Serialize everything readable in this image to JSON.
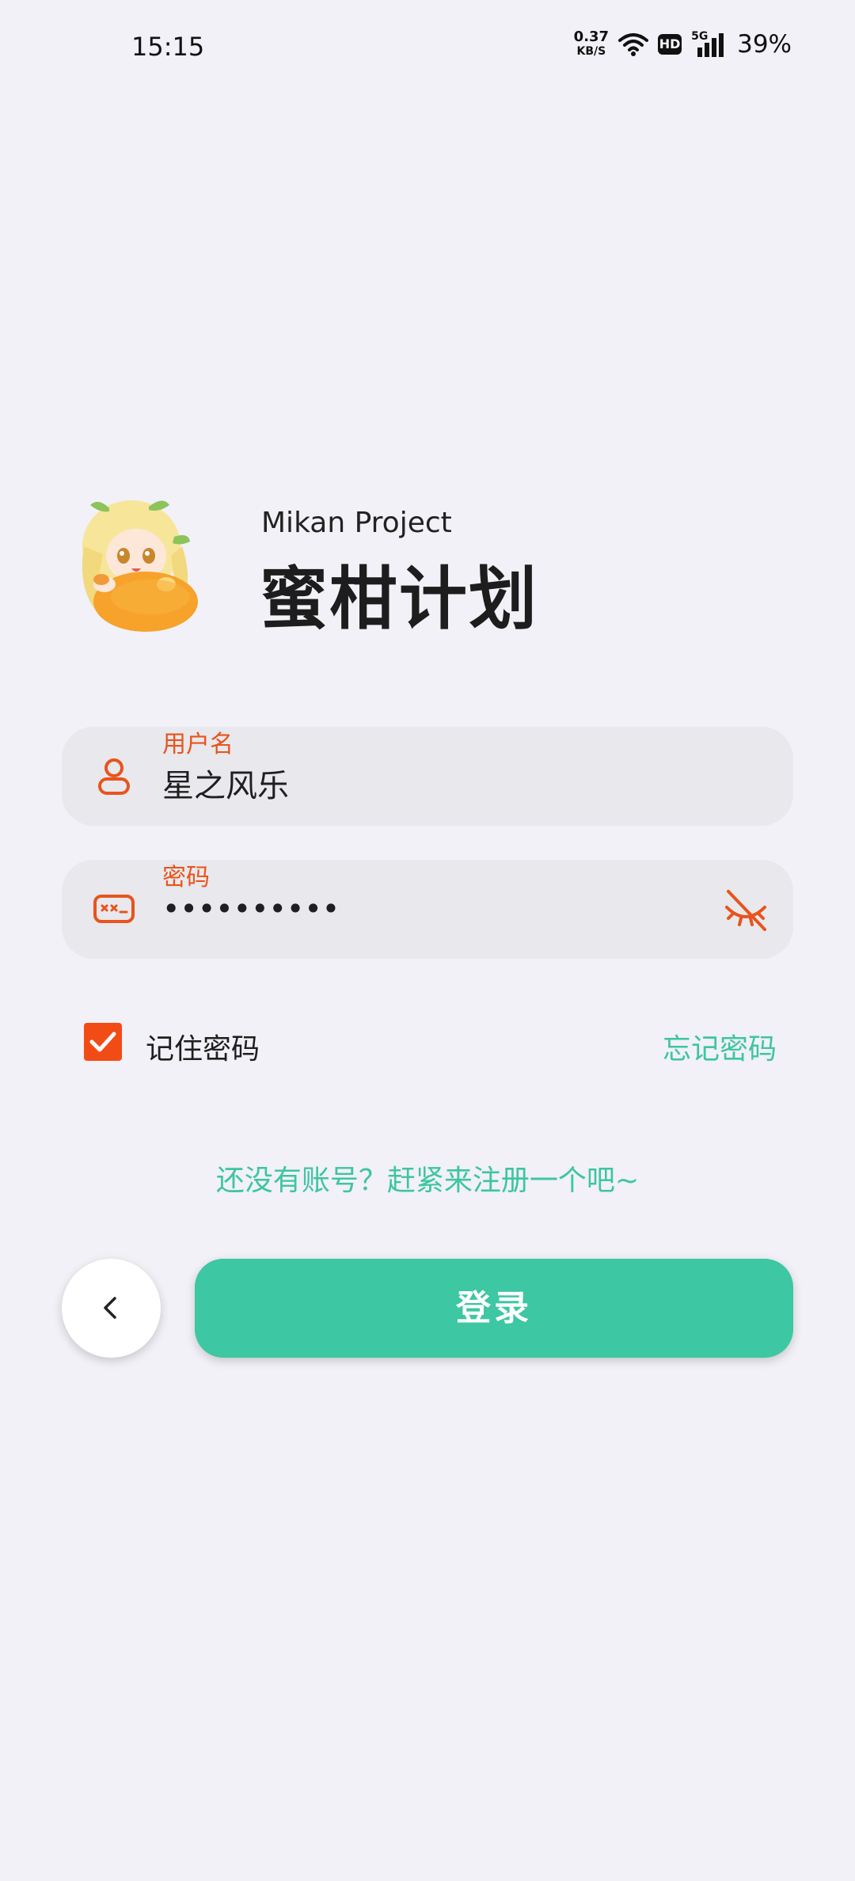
{
  "status_bar": {
    "time": "15:15",
    "net_speed_value": "0.37",
    "net_speed_unit": "KB/S",
    "hd_label": "HD",
    "network_type": "5G",
    "battery": "39%",
    "icons": [
      "wifi-icon",
      "hd-icon",
      "signal-5g-icon"
    ]
  },
  "brand": {
    "subtitle": "Mikan Project",
    "title": "蜜柑计划",
    "logo": "mascot-logo"
  },
  "form": {
    "username": {
      "label": "用户名",
      "value": "星之风乐",
      "icon": "user-icon"
    },
    "password": {
      "label": "密码",
      "value": "••••••••••",
      "icon": "password-icon",
      "toggle_icon": "eye-off-icon"
    },
    "remember": {
      "label": "记住密码",
      "checked": true
    },
    "forgot_label": "忘记密码",
    "register_label": "还没有账号？赶紧来注册一个吧~",
    "login_label": "登录",
    "back_icon": "chevron-left-icon"
  },
  "colors": {
    "accent": "#3dc7a2",
    "warning": "#e8541b",
    "background": "#f1f1f7",
    "field_bg": "#e8e8ed"
  }
}
